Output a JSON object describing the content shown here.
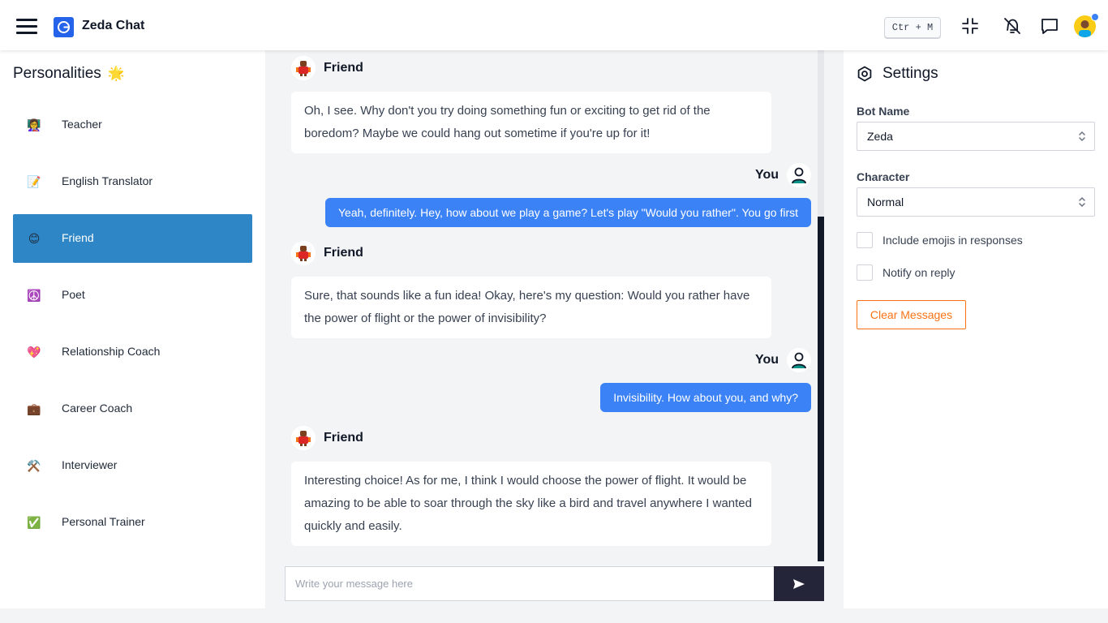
{
  "header": {
    "app_title": "Zeda Chat",
    "shortcut": "Ctr + M",
    "icons": [
      "menu-icon",
      "app-logo-icon",
      "collapse-icon",
      "mute-bell-icon",
      "chat-bubble-icon",
      "avatar"
    ],
    "avatar_badge_color": "#3b82f6"
  },
  "sidebar": {
    "title": "Personalities",
    "title_emoji": "🌟",
    "items": [
      {
        "label": "Teacher",
        "emoji": "👩‍🏫",
        "active": false
      },
      {
        "label": "English Translator",
        "emoji": "📝",
        "active": false
      },
      {
        "label": "Friend",
        "emoji": "😊",
        "active": true
      },
      {
        "label": "Poet",
        "emoji": "☮️",
        "active": false
      },
      {
        "label": "Relationship Coach",
        "emoji": "💖",
        "active": false
      },
      {
        "label": "Career Coach",
        "emoji": "💼",
        "active": false
      },
      {
        "label": "Interviewer",
        "emoji": "⚒️",
        "active": false
      },
      {
        "label": "Personal Trainer",
        "emoji": "✅",
        "active": false
      }
    ],
    "active_color": "#2e86c6"
  },
  "chat": {
    "messages": [
      {
        "role": "bot",
        "name": "Friend",
        "text": "Oh, I see. Why don't you try doing something fun or exciting to get rid of the boredom? Maybe we could hang out sometime if you're up for it!"
      },
      {
        "role": "user",
        "name": "You",
        "text": "Yeah, definitely. Hey, how about we play a game? Let's play \"Would you rather\". You go first"
      },
      {
        "role": "bot",
        "name": "Friend",
        "text": "Sure, that sounds like a fun idea! Okay, here's my question: Would you rather have the power of flight or the power of invisibility?"
      },
      {
        "role": "user",
        "name": "You",
        "text": "Invisibility. How about you, and why?"
      },
      {
        "role": "bot",
        "name": "Friend",
        "text": "Interesting choice! As for me, I think I would choose the power of flight. It would be amazing to be able to soar through the sky like a bird and travel anywhere I wanted quickly and easily."
      }
    ],
    "input": {
      "value": "",
      "placeholder": "Write your message here"
    },
    "user_bubble_color": "#3b82f6",
    "send_button_color": "#25253a"
  },
  "settings": {
    "title": "Settings",
    "bot_name_label": "Bot Name",
    "bot_name_value": "Zeda",
    "character_label": "Character",
    "character_value": "Normal",
    "include_emojis_label": "Include emojis in responses",
    "include_emojis_checked": false,
    "notify_label": "Notify on reply",
    "notify_checked": false,
    "clear_button": "Clear Messages",
    "clear_button_color": "#f97316"
  }
}
